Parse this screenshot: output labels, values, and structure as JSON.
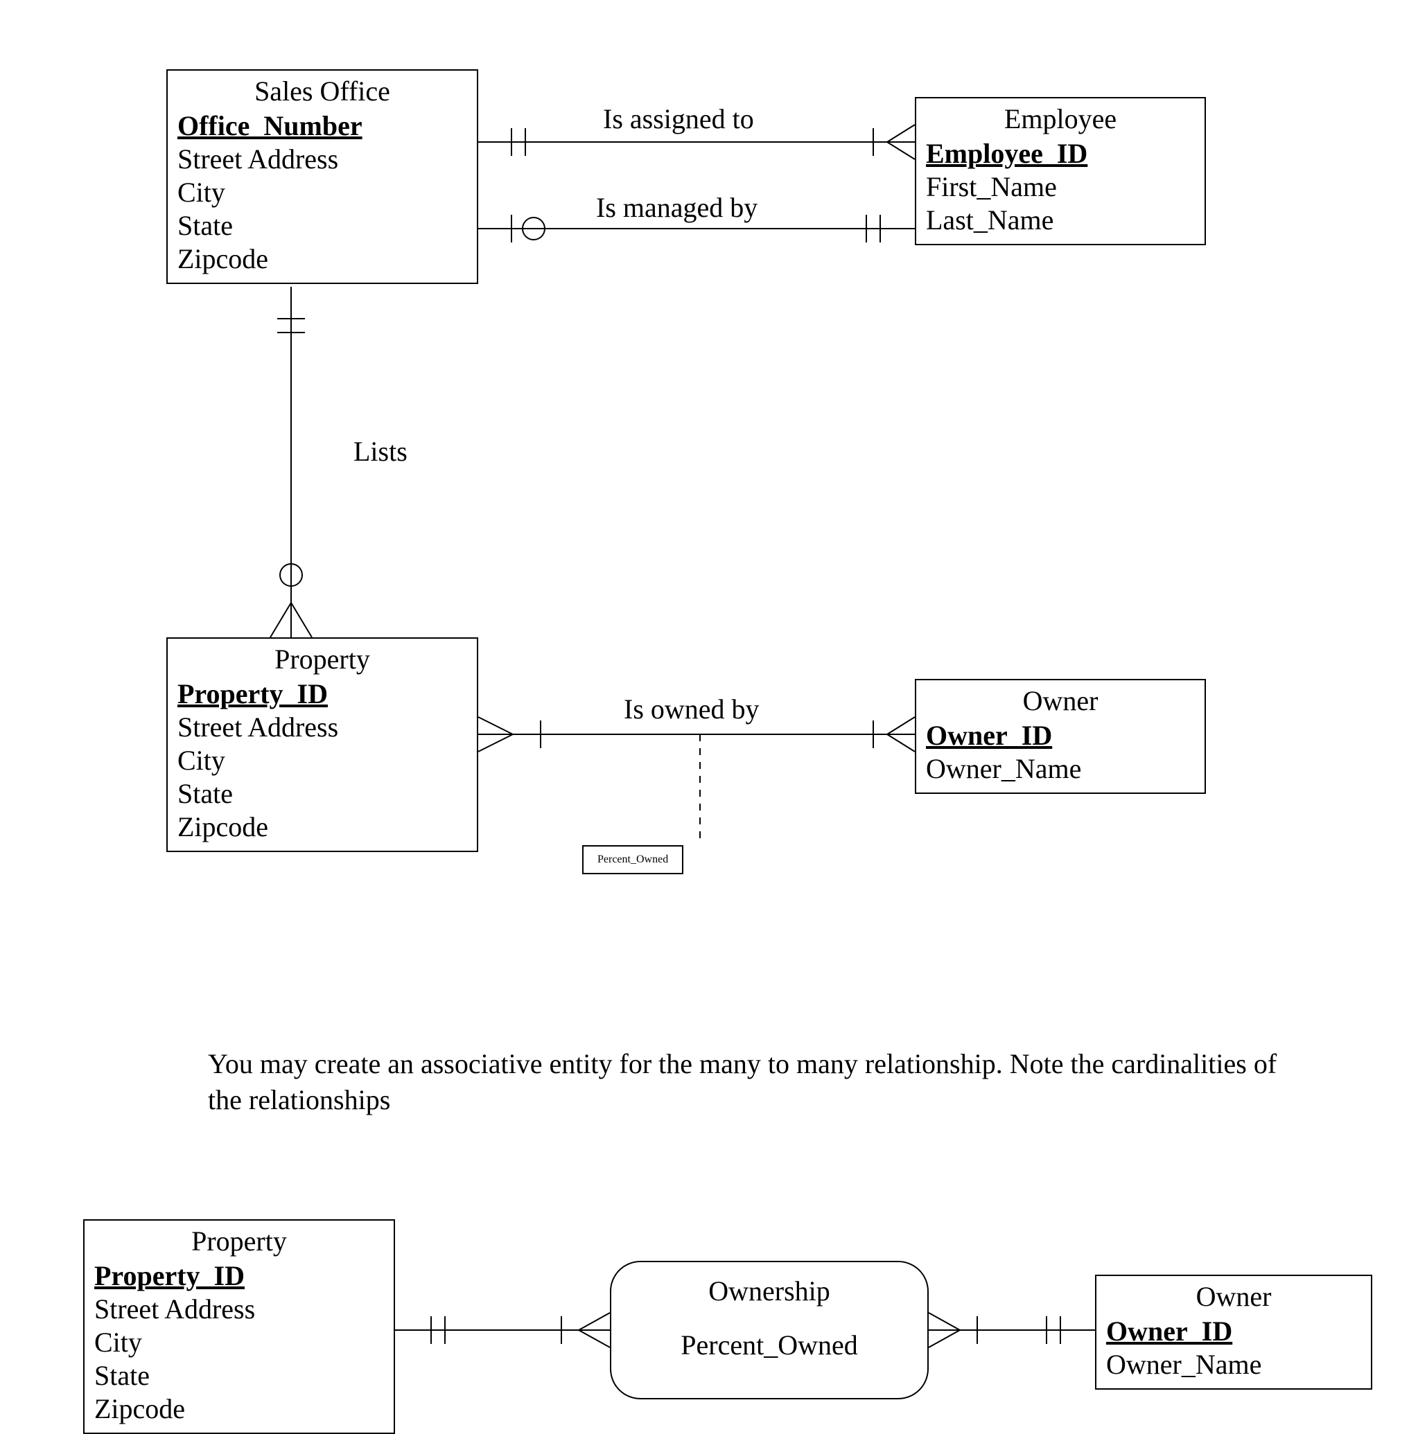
{
  "entities": {
    "sales_office": {
      "name": "Sales Office",
      "pk": "Office_Number",
      "attrs": [
        "Street Address",
        "City",
        "State",
        "Zipcode"
      ]
    },
    "employee": {
      "name": "Employee",
      "pk": "Employee_ID",
      "attrs": [
        "First_Name",
        "Last_Name"
      ]
    },
    "property": {
      "name": "Property",
      "pk": "Property_ID",
      "attrs": [
        "Street Address",
        "City",
        "State",
        "Zipcode"
      ]
    },
    "owner": {
      "name": "Owner",
      "pk": "Owner_ID",
      "attrs": [
        "Owner_Name"
      ]
    },
    "property2": {
      "name": "Property",
      "pk": "Property_ID",
      "attrs": [
        "Street Address",
        "City",
        "State",
        "Zipcode"
      ]
    },
    "owner2": {
      "name": "Owner",
      "pk": "Owner_ID",
      "attrs": [
        "Owner_Name"
      ]
    }
  },
  "assoc": {
    "ownership": {
      "name": "Ownership",
      "attr": "Percent_Owned"
    }
  },
  "rel_labels": {
    "r1": "Is assigned to",
    "r2": "Is managed by",
    "r3": "Lists",
    "r4": "Is owned by"
  },
  "attr_box": {
    "percent_owned": "Percent_Owned"
  },
  "note": "You may create an associative entity for the many to many relationship. Note the cardinalities of the relationships"
}
